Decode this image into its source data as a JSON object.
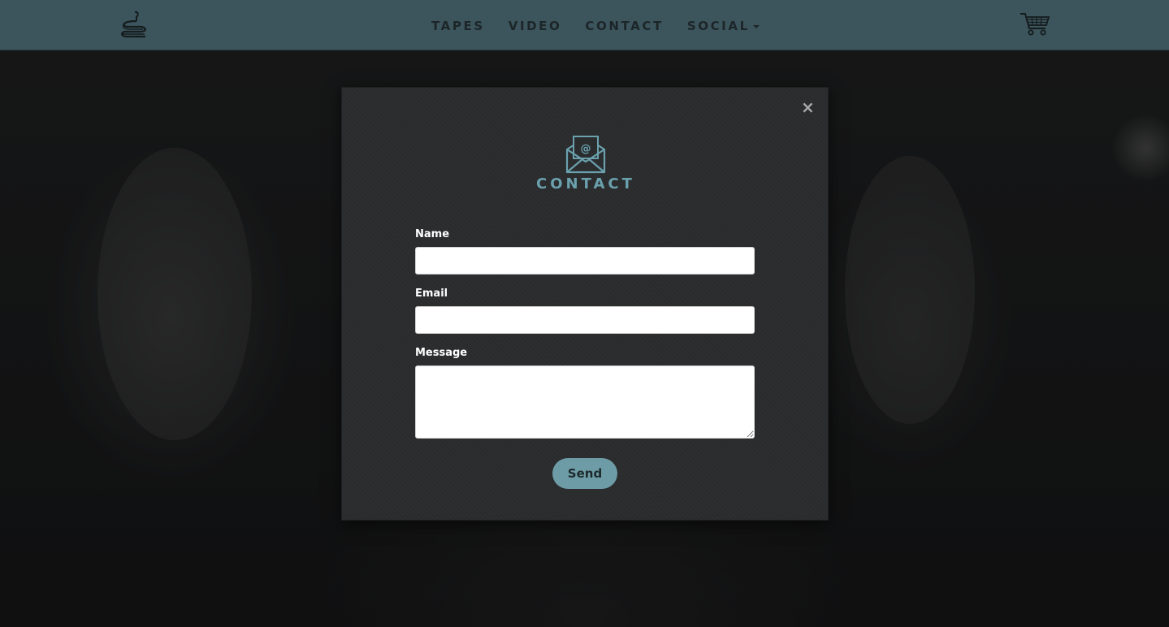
{
  "header": {
    "nav": [
      {
        "label": "TAPES"
      },
      {
        "label": "VIDEO"
      },
      {
        "label": "CONTACT"
      },
      {
        "label": "SOCIAL",
        "has_dropdown": true
      }
    ],
    "logo_icon": "snake-logo-icon",
    "cart_icon": "shopping-cart-icon"
  },
  "modal": {
    "title": "CONTACT",
    "icon": "envelope-at-icon",
    "close_label": "×",
    "fields": {
      "name": {
        "label": "Name",
        "value": ""
      },
      "email": {
        "label": "Email",
        "value": ""
      },
      "message": {
        "label": "Message",
        "value": ""
      }
    },
    "send_label": "Send"
  },
  "colors": {
    "header_bg": "#3c545b",
    "accent": "#6aa1ad",
    "button_bg": "#6e9ca6",
    "modal_bg": "#2a2c2e"
  }
}
